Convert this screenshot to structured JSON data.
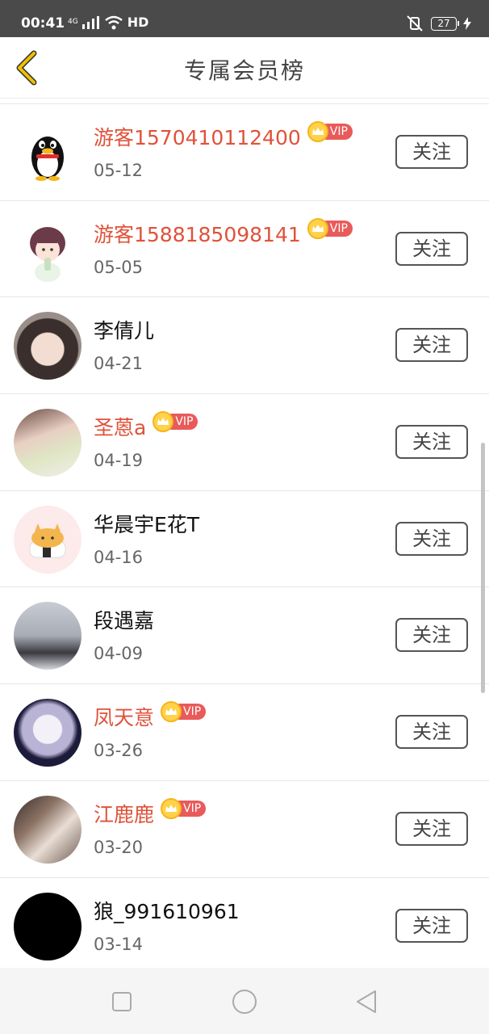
{
  "status_bar": {
    "time": "00:41",
    "network": "4G",
    "hd": "HD",
    "battery": "27"
  },
  "header": {
    "title": "专属会员榜"
  },
  "vip_label": "VIP",
  "follow_label": "关注",
  "members": [
    {
      "name": "游客1570410112400",
      "date": "05-12",
      "vip": true,
      "avatar": "penguin"
    },
    {
      "name": "游客1588185098141",
      "date": "05-05",
      "vip": true,
      "avatar": "cartoon-girl"
    },
    {
      "name": "李倩儿",
      "date": "04-21",
      "vip": false,
      "avatar": "photo"
    },
    {
      "name": "圣蒽a",
      "date": "04-19",
      "vip": true,
      "avatar": "photo"
    },
    {
      "name": "华晨宇E花T",
      "date": "04-16",
      "vip": false,
      "avatar": "sushi-dog"
    },
    {
      "name": "段遇嘉",
      "date": "04-09",
      "vip": false,
      "avatar": "photo"
    },
    {
      "name": "凤天意",
      "date": "03-26",
      "vip": true,
      "avatar": "photo"
    },
    {
      "name": "江鹿鹿",
      "date": "03-20",
      "vip": true,
      "avatar": "photo"
    },
    {
      "name": "狼_991610961",
      "date": "03-14",
      "vip": false,
      "avatar": "black"
    }
  ],
  "colors": {
    "vip_name": "#e0523a",
    "vip_tag": "#e95a5a",
    "back_arrow": "#f0c000"
  }
}
